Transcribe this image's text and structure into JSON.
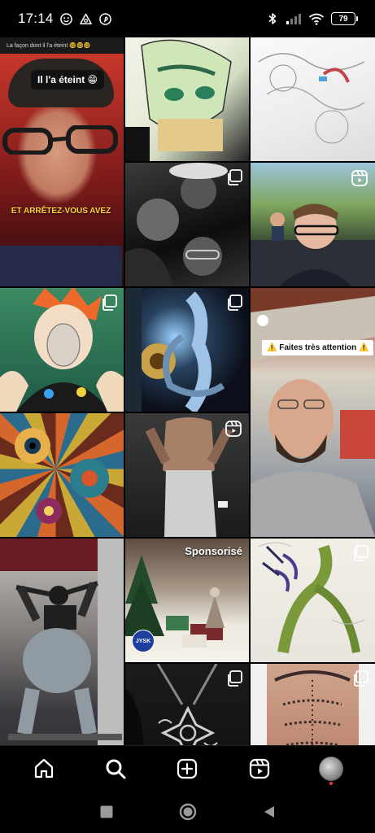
{
  "status_bar": {
    "time": "17:14",
    "battery": "79",
    "left_icons": [
      "emoji-icon",
      "warning-icon",
      "pinterest-icon"
    ],
    "right_icons": [
      "bluetooth-icon",
      "signal-icon",
      "wifi-icon",
      "battery-icon"
    ]
  },
  "grid": {
    "tiles": [
      {
        "id": "post-1",
        "top_caption": "La façon dont il l'a éteint 🤓🤓🤓",
        "bubble": "Il l'a éteint 😁",
        "bottom_caption": "ET ARRÊTEZ-VOUS AVEZ"
      },
      {
        "id": "post-2",
        "overlay": "none"
      },
      {
        "id": "post-3",
        "overlay": "none"
      },
      {
        "id": "post-4",
        "overlay": "multi-photo-icon"
      },
      {
        "id": "post-5",
        "overlay": "reel-icon"
      },
      {
        "id": "post-6",
        "overlay": "multi-photo-icon"
      },
      {
        "id": "post-7",
        "overlay": "multi-photo-icon"
      },
      {
        "id": "post-8",
        "warning_text": "⚠️ Faites très attention ⚠️"
      },
      {
        "id": "post-9",
        "overlay": "none"
      },
      {
        "id": "post-10",
        "overlay": "reel-icon"
      },
      {
        "id": "post-11",
        "sponsored_label": "Sponsorisé",
        "brand_badge": "JYSK"
      },
      {
        "id": "post-12",
        "overlay": "none"
      },
      {
        "id": "post-13",
        "overlay": "multi-photo-icon"
      },
      {
        "id": "post-14",
        "overlay": "multi-photo-icon"
      },
      {
        "id": "post-15",
        "overlay": "multi-photo-icon"
      }
    ]
  },
  "bottom_nav": {
    "items": [
      "home-icon",
      "search-icon",
      "create-icon",
      "reels-icon",
      "profile-avatar"
    ],
    "active": "search-icon"
  },
  "system_nav": {
    "buttons": [
      "recents-button",
      "home-button",
      "back-button"
    ]
  },
  "colors": {
    "background": "#000000",
    "notification_dot": "#ff3040",
    "caption_yellow": "#ffd23a"
  }
}
